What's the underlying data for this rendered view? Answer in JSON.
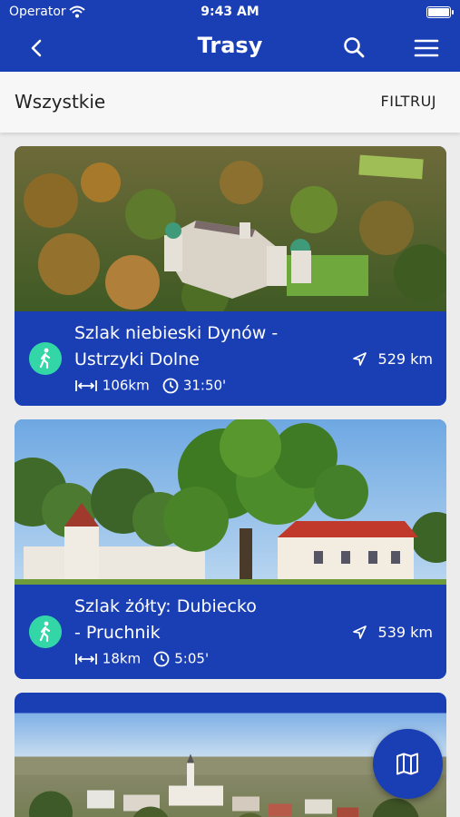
{
  "status_bar": {
    "carrier": "Operator",
    "time": "9:43 AM"
  },
  "header": {
    "title": "Trasy"
  },
  "filter_bar": {
    "label": "Wszystkie",
    "filter_label": "FILTRUJ"
  },
  "routes": [
    {
      "name_line1": "Szlak niebieski Dynów -",
      "name_line2": "Ustrzyki Dolne",
      "length": "106km",
      "time": "31:50'",
      "distance": "529 km"
    },
    {
      "name_line1": "Szlak żółty: Dubiecko",
      "name_line2": "- Pruchnik",
      "length": "18km",
      "time": "5:05'",
      "distance": "539 km"
    }
  ],
  "colors": {
    "primary": "#1a3fb4",
    "accent": "#33d6a6",
    "background": "#ececec"
  },
  "icons": [
    "back-icon",
    "search-icon",
    "menu-icon",
    "walk-icon",
    "length-icon",
    "clock-icon",
    "navigation-arrow-icon",
    "map-icon"
  ]
}
